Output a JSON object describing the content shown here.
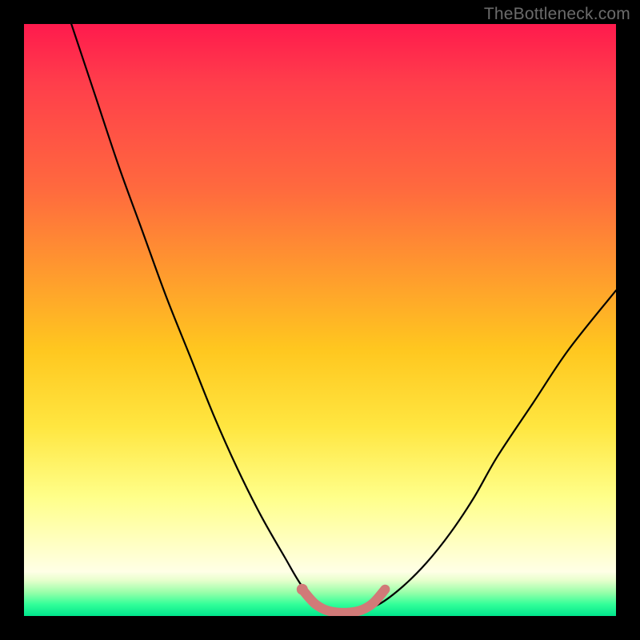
{
  "watermark": "TheBottleneck.com",
  "chart_data": {
    "type": "line",
    "title": "",
    "xlabel": "",
    "ylabel": "",
    "xlim": [
      0,
      100
    ],
    "ylim": [
      0,
      100
    ],
    "grid": false,
    "legend": false,
    "series": [
      {
        "name": "bottleneck-curve",
        "color": "#000000",
        "x": [
          8,
          12,
          16,
          20,
          24,
          28,
          32,
          36,
          40,
          44,
          47,
          50,
          53,
          56,
          60,
          64,
          68,
          72,
          76,
          80,
          86,
          92,
          100
        ],
        "values": [
          100,
          88,
          76,
          65,
          54,
          44,
          34,
          25,
          17,
          10,
          5,
          2,
          0.5,
          0.5,
          2,
          5,
          9,
          14,
          20,
          27,
          36,
          45,
          55
        ]
      },
      {
        "name": "highlight-band",
        "color": "#d17a78",
        "x": [
          47,
          49,
          51,
          53,
          55,
          57,
          59,
          61
        ],
        "values": [
          4.5,
          2.2,
          1.0,
          0.6,
          0.6,
          1.0,
          2.2,
          4.5
        ]
      }
    ],
    "annotations": [
      {
        "name": "highlight-dot",
        "x": 47,
        "y": 4.5,
        "color": "#d17a78"
      }
    ],
    "background_gradient": {
      "orientation": "vertical",
      "stops": [
        {
          "pos": 0.0,
          "color": "#ff1a4d"
        },
        {
          "pos": 0.55,
          "color": "#ffc71f"
        },
        {
          "pos": 0.8,
          "color": "#ffff8a"
        },
        {
          "pos": 0.93,
          "color": "#ffffe0"
        },
        {
          "pos": 1.0,
          "color": "#00e68c"
        }
      ]
    }
  }
}
